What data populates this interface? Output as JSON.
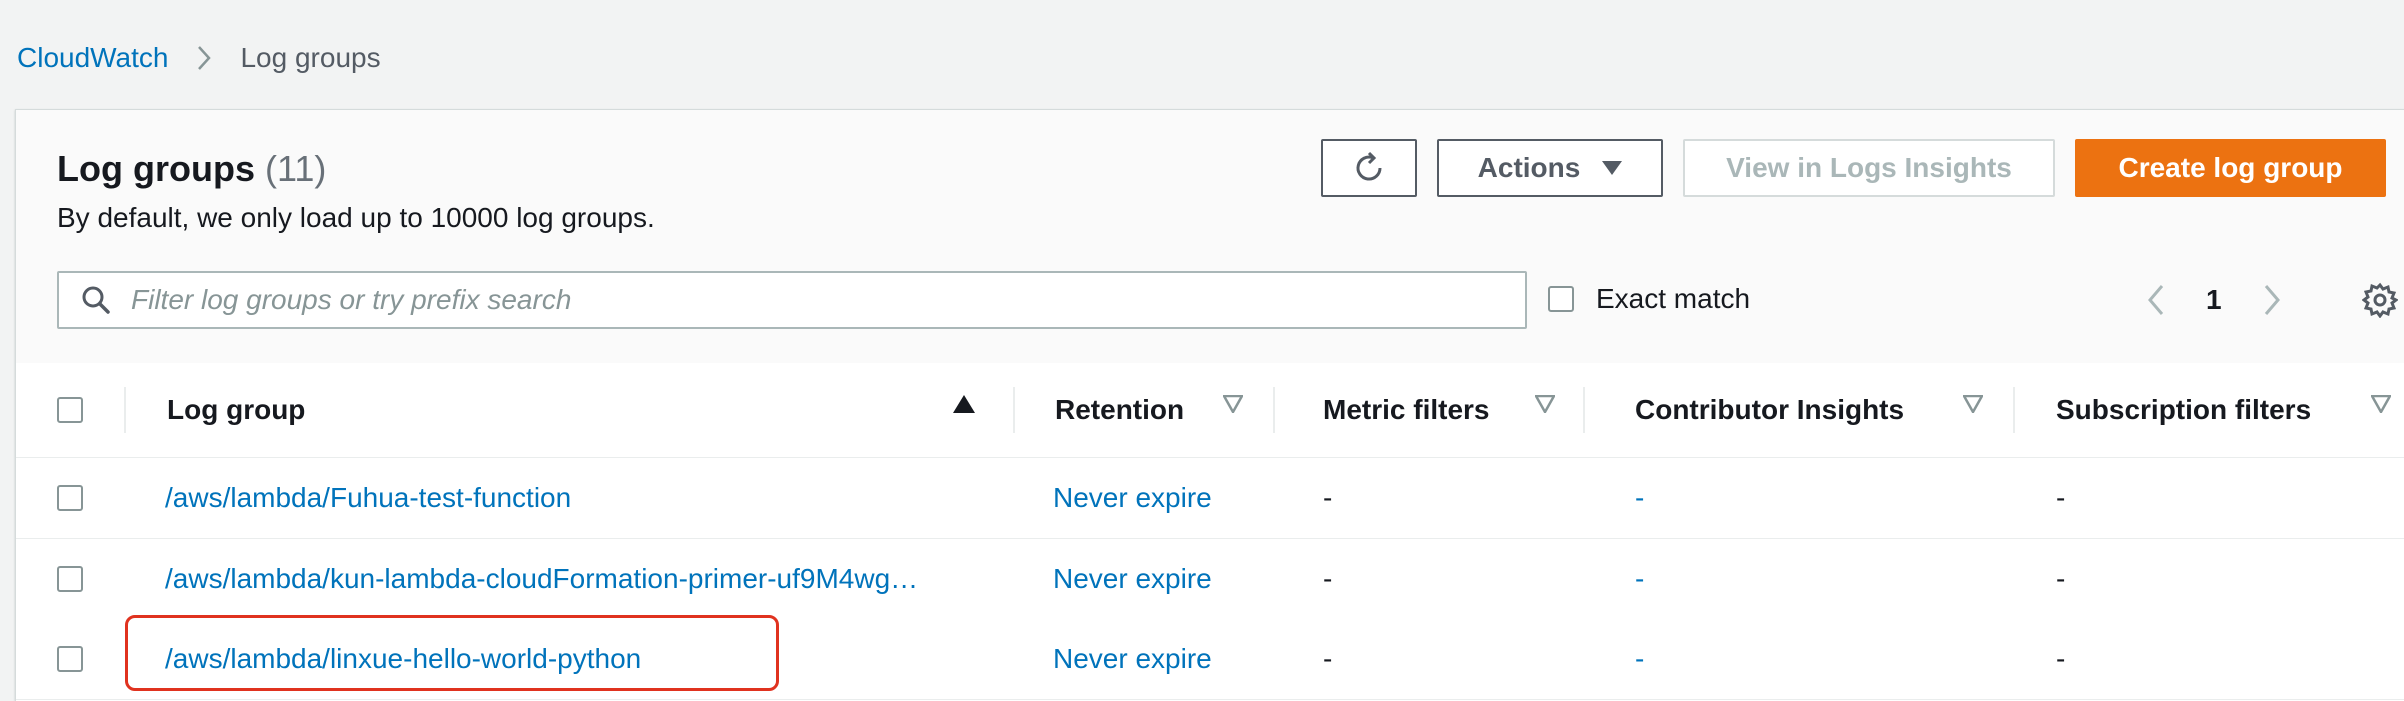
{
  "breadcrumb": {
    "root": "CloudWatch",
    "current": "Log groups"
  },
  "header": {
    "title": "Log groups",
    "count": "(11)",
    "subtitle": "By default, we only load up to 10000 log groups.",
    "actions_label": "Actions",
    "insights_label": "View in Logs Insights",
    "create_label": "Create log group"
  },
  "search": {
    "placeholder": "Filter log groups or try prefix search",
    "value": ""
  },
  "exact_match_label": "Exact match",
  "pagination": {
    "current_page": "1"
  },
  "table": {
    "columns": [
      "Log group",
      "Retention",
      "Metric filters",
      "Contributor Insights",
      "Subscription filters"
    ],
    "rows": [
      {
        "log_group": "/aws/lambda/Fuhua-test-function",
        "retention": "Never expire",
        "metric_filters": "-",
        "contributor_insights": "-",
        "subscription_filters": "-"
      },
      {
        "log_group": "/aws/lambda/kun-lambda-cloudFormation-primer-uf9M4wg…",
        "retention": "Never expire",
        "metric_filters": "-",
        "contributor_insights": "-",
        "subscription_filters": "-"
      },
      {
        "log_group": "/aws/lambda/linxue-hello-world-python",
        "retention": "Never expire",
        "metric_filters": "-",
        "contributor_insights": "-",
        "subscription_filters": "-"
      }
    ]
  },
  "colors": {
    "link": "#0073bb",
    "primary": "#ec7211",
    "highlight": "#e0321f"
  }
}
